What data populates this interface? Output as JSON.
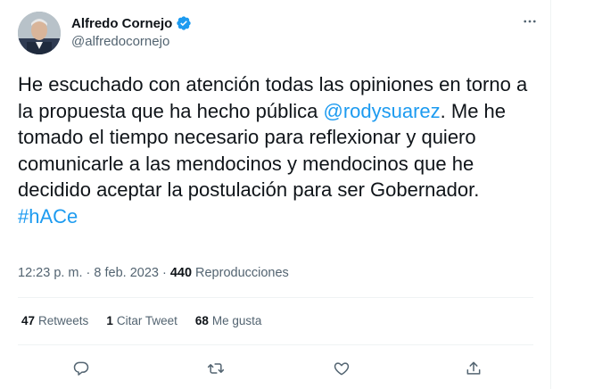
{
  "author": {
    "name": "Alfredo Cornejo",
    "handle": "@alfredocornejo",
    "avatar_icon": "profile-photo"
  },
  "tweet": {
    "text_part1": "He escuchado con atención todas las opiniones en torno a la propuesta que ha hecho pública ",
    "mention": "@rodysuarez",
    "text_part2": ". Me he tomado el tiempo necesario para reflexionar y quiero comunicarle a las mendocinos y mendocinos que he decidido aceptar la postulación para ser Gobernador.",
    "hashtag": "#hACe"
  },
  "meta": {
    "time": "12:23 p. m.",
    "separator": "·",
    "date": "8 feb. 2023",
    "views_count": "440",
    "views_label": "Reproducciones"
  },
  "stats": {
    "retweets_count": "47",
    "retweets_label": "Retweets",
    "quotes_count": "1",
    "quotes_label": "Citar Tweet",
    "likes_count": "68",
    "likes_label": "Me gusta"
  },
  "colors": {
    "accent": "#1d9bf0",
    "text": "#0f1419",
    "muted": "#536471",
    "border": "#eff3f4"
  }
}
